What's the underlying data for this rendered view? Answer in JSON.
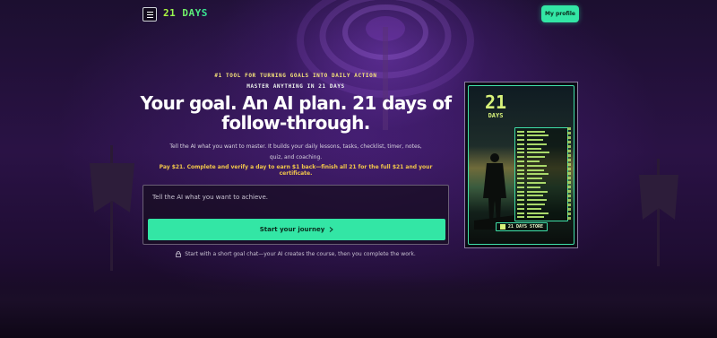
{
  "header": {
    "brand": "21 DAYS",
    "profile_button": "My profile",
    "menu_icon": "hamburger-icon"
  },
  "hero": {
    "eyebrow_primary": "#1 TOOL FOR TURNING GOALS INTO DAILY ACTION",
    "eyebrow_secondary": "MASTER ANYTHING IN 21 DAYS",
    "headline": "Your goal. An AI plan. 21 days of follow-through.",
    "subcopy": "Tell the AI what you want to master. It builds your daily lessons, tasks, checklist, timer, notes, quiz, and coaching.",
    "pay_text": "Pay $21. Complete and verify a day to earn $1 back—finish all 21 for the full $21 and your certificate."
  },
  "goal_form": {
    "placeholder": "Tell the AI what you want to achieve.",
    "start_button": "Start your journey",
    "start_icon": "chevron-right-icon"
  },
  "footnote": {
    "text": "Start with a short goal chat—your AI creates the course, then you complete the work.",
    "icon": "lock-icon"
  },
  "poster": {
    "number": "21",
    "word": "DAYS",
    "store_label": "21 DAYS STORE"
  },
  "colors": {
    "accent": "#33e6a5",
    "eyebrow": "#f5e27a",
    "pay_text": "#f2c74a",
    "background": "#1c0f30"
  }
}
